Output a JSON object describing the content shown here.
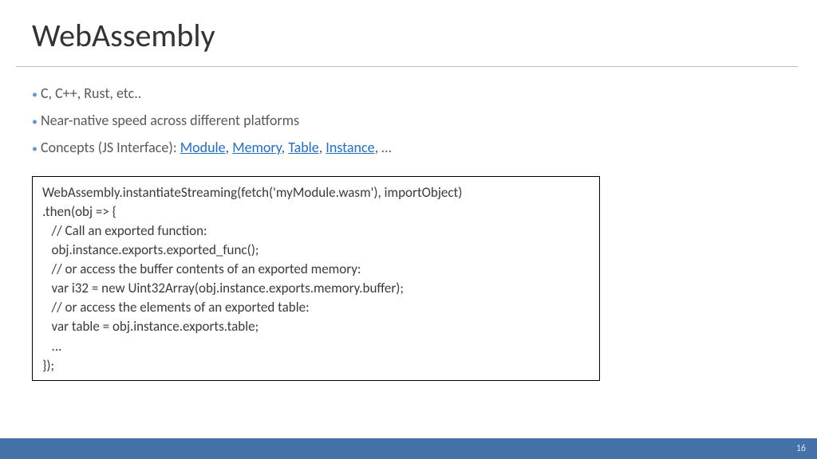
{
  "title": "WebAssembly",
  "bullets": {
    "b0": "C, C++, Rust, etc..",
    "b1": "Near-native speed across different platforms",
    "b2_prefix": "Concepts (JS Interface): ",
    "links": {
      "module": "Module",
      "memory": "Memory",
      "table": "Table",
      "instance": "Instance"
    },
    "b2_suffix": ", …"
  },
  "code": {
    "l0": "WebAssembly.instantiateStreaming(fetch('myModule.wasm'), importObject)",
    "l1": ".then(obj => {",
    "l2": "   // Call an exported function:",
    "l3": "   obj.instance.exports.exported_func();",
    "l4": "   // or access the buffer contents of an exported memory:",
    "l5": "   var i32 = new Uint32Array(obj.instance.exports.memory.buffer);",
    "l6": "   // or access the elements of an exported table:",
    "l7": "   var table = obj.instance.exports.table;",
    "l8": "   ...",
    "l9": "});"
  },
  "page_number": "16",
  "sep_comma": ", "
}
